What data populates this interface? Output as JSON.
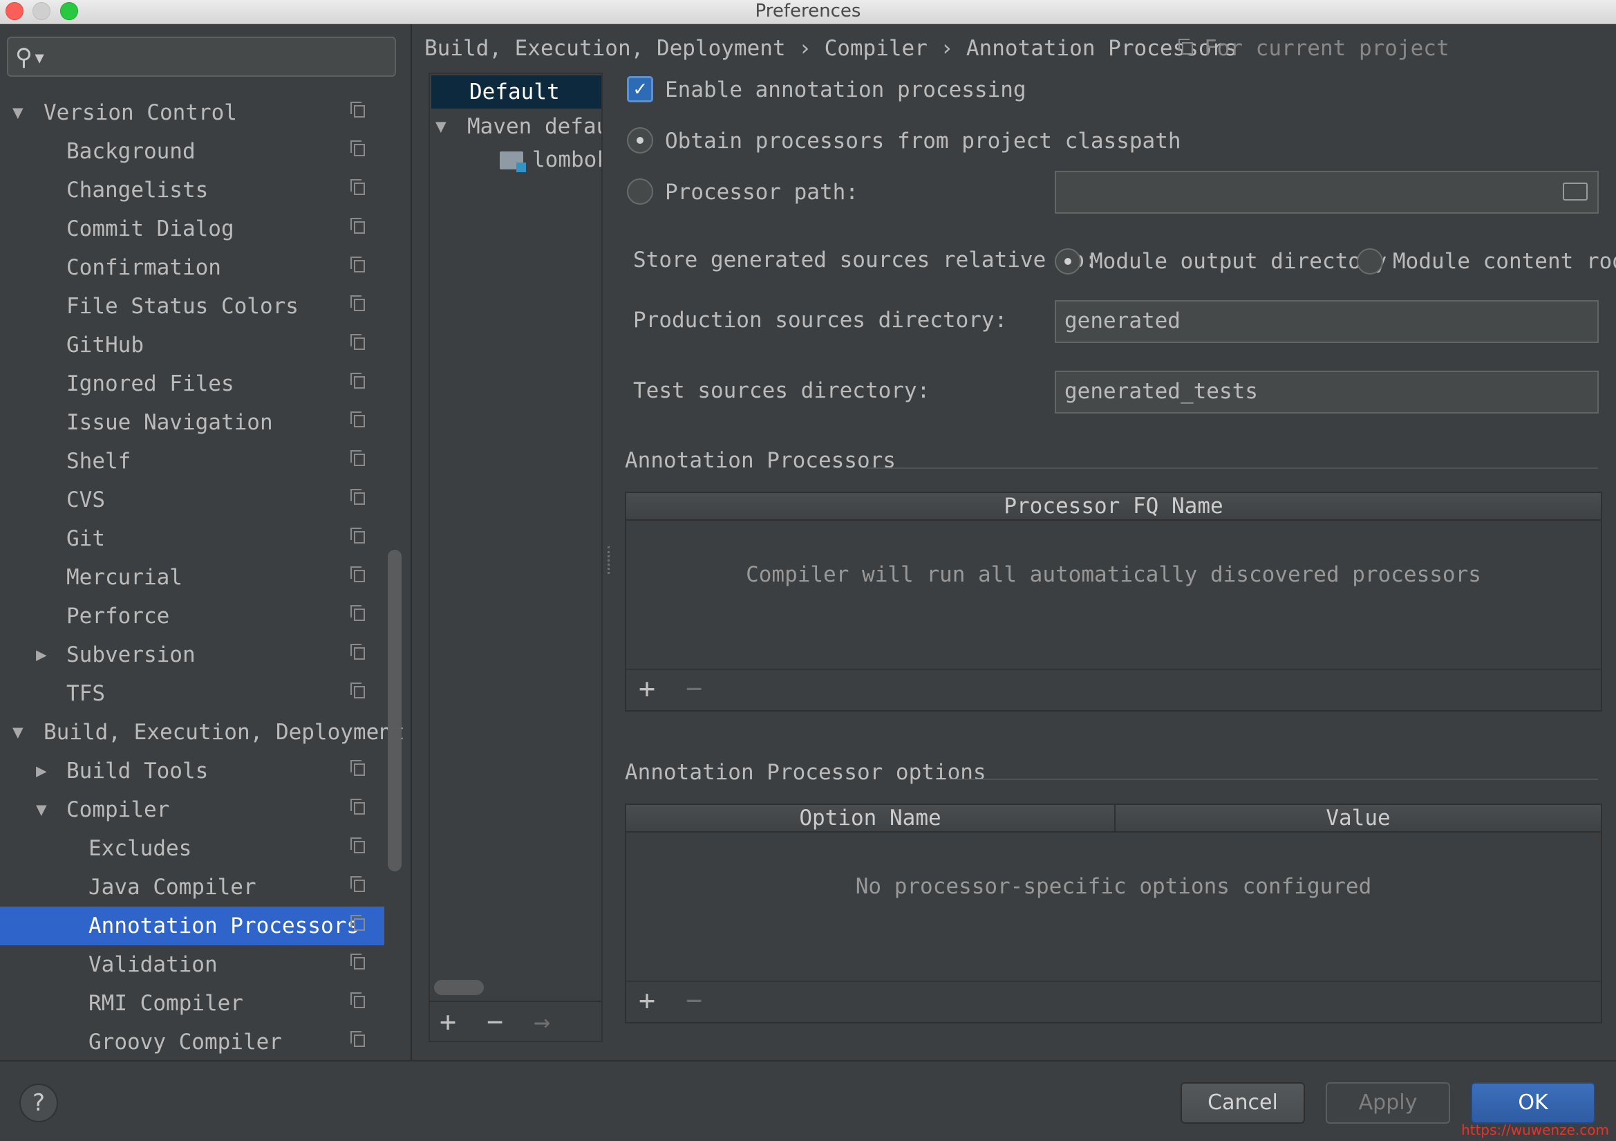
{
  "window": {
    "title": "Preferences"
  },
  "search": {
    "placeholder": ""
  },
  "sidebar": {
    "items": [
      {
        "label": "Version Control",
        "level": 0,
        "arrow": "down",
        "copy": true
      },
      {
        "label": "Background",
        "level": 1,
        "arrow": "",
        "copy": true
      },
      {
        "label": "Changelists",
        "level": 1,
        "arrow": "",
        "copy": true
      },
      {
        "label": "Commit Dialog",
        "level": 1,
        "arrow": "",
        "copy": true
      },
      {
        "label": "Confirmation",
        "level": 1,
        "arrow": "",
        "copy": true
      },
      {
        "label": "File Status Colors",
        "level": 1,
        "arrow": "",
        "copy": true
      },
      {
        "label": "GitHub",
        "level": 1,
        "arrow": "",
        "copy": true
      },
      {
        "label": "Ignored Files",
        "level": 1,
        "arrow": "",
        "copy": true
      },
      {
        "label": "Issue Navigation",
        "level": 1,
        "arrow": "",
        "copy": true
      },
      {
        "label": "Shelf",
        "level": 1,
        "arrow": "",
        "copy": true
      },
      {
        "label": "CVS",
        "level": 1,
        "arrow": "",
        "copy": true
      },
      {
        "label": "Git",
        "level": 1,
        "arrow": "",
        "copy": true
      },
      {
        "label": "Mercurial",
        "level": 1,
        "arrow": "",
        "copy": true
      },
      {
        "label": "Perforce",
        "level": 1,
        "arrow": "",
        "copy": true
      },
      {
        "label": "Subversion",
        "level": 1,
        "arrow": "right",
        "copy": true
      },
      {
        "label": "TFS",
        "level": 1,
        "arrow": "",
        "copy": true
      },
      {
        "label": "Build, Execution, Deployment",
        "level": 0,
        "arrow": "down",
        "copy": false
      },
      {
        "label": "Build Tools",
        "level": 1,
        "arrow": "right",
        "copy": true
      },
      {
        "label": "Compiler",
        "level": 1,
        "arrow": "down",
        "copy": true
      },
      {
        "label": "Excludes",
        "level": 2,
        "arrow": "",
        "copy": true
      },
      {
        "label": "Java Compiler",
        "level": 2,
        "arrow": "",
        "copy": true
      },
      {
        "label": "Annotation Processors",
        "level": 2,
        "arrow": "",
        "copy": true,
        "selected": true
      },
      {
        "label": "Validation",
        "level": 2,
        "arrow": "",
        "copy": true
      },
      {
        "label": "RMI Compiler",
        "level": 2,
        "arrow": "",
        "copy": true
      },
      {
        "label": "Groovy Compiler",
        "level": 2,
        "arrow": "",
        "copy": true
      }
    ]
  },
  "breadcrumb": {
    "text": "Build, Execution, Deployment › Compiler › Annotation Processors",
    "scope": "For current project"
  },
  "profiles": {
    "default": "Default",
    "maven": "Maven default",
    "lombok": "lombok-"
  },
  "options": {
    "enable_label": "Enable annotation processing",
    "obtain_label": "Obtain processors from project classpath",
    "processor_path_label": "Processor path:",
    "processor_path_value": "",
    "store_label": "Store generated sources relative to:",
    "module_output_label": "Module output directory",
    "module_content_label": "Module content root",
    "production_label": "Production sources directory:",
    "production_value": "generated",
    "test_label": "Test sources directory:",
    "test_value": "generated_tests"
  },
  "processors": {
    "title": "Annotation Processors",
    "column": "Processor FQ Name",
    "empty": "Compiler will run all automatically discovered processors"
  },
  "processor_options": {
    "title": "Annotation Processor options",
    "col_name": "Option Name",
    "col_value": "Value",
    "empty": "No processor-specific options configured"
  },
  "toolbar": {
    "add": "+",
    "remove": "−",
    "move": "→"
  },
  "footer": {
    "help": "?",
    "cancel": "Cancel",
    "apply": "Apply",
    "ok": "OK",
    "watermark": "https://wuwenze.com"
  },
  "colors": {
    "accent": "#2f65ca",
    "primary_button": "#3c6fbc",
    "background": "#3c3f41"
  }
}
